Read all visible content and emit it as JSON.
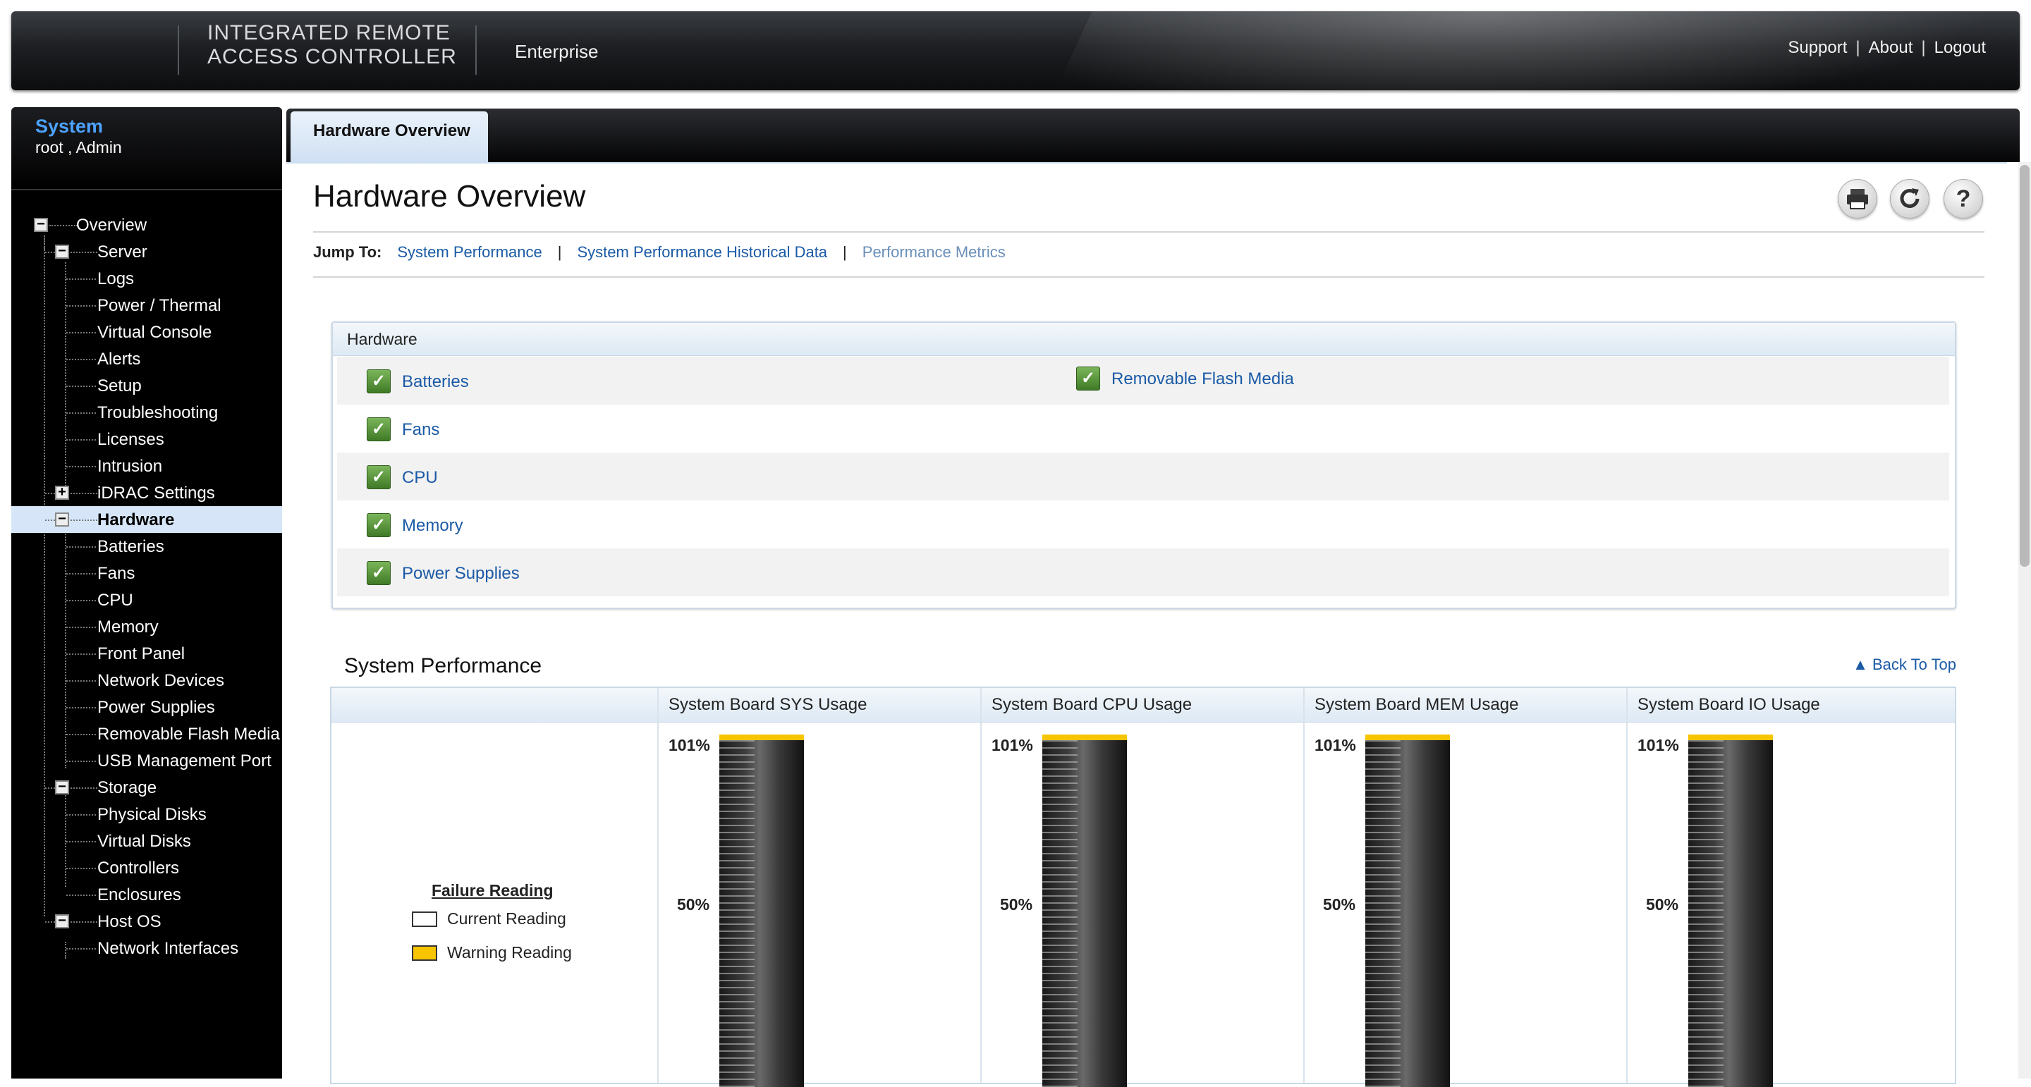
{
  "header": {
    "brand_line1": "INTEGRATED REMOTE",
    "brand_line2": "ACCESS CONTROLLER",
    "edition": "Enterprise",
    "links": {
      "support": "Support",
      "about": "About",
      "logout": "Logout",
      "separator": "|"
    }
  },
  "sidebar": {
    "title": "System",
    "user": "root , Admin",
    "tree": {
      "overview": "Overview",
      "server": "Server",
      "logs": "Logs",
      "power_thermal": "Power / Thermal",
      "virtual_console": "Virtual Console",
      "alerts": "Alerts",
      "setup": "Setup",
      "troubleshooting": "Troubleshooting",
      "licenses": "Licenses",
      "intrusion": "Intrusion",
      "idrac_settings": "iDRAC Settings",
      "hardware": "Hardware",
      "batteries": "Batteries",
      "fans": "Fans",
      "cpu": "CPU",
      "memory": "Memory",
      "front_panel": "Front Panel",
      "network_devices": "Network Devices",
      "power_supplies": "Power Supplies",
      "removable_flash_media": "Removable Flash Media",
      "usb_management_port": "USB Management Port",
      "storage": "Storage",
      "physical_disks": "Physical Disks",
      "virtual_disks": "Virtual Disks",
      "controllers": "Controllers",
      "enclosures": "Enclosures",
      "host_os": "Host OS",
      "network_interfaces": "Network Interfaces"
    },
    "selected": "Hardware"
  },
  "tab": {
    "label": "Hardware Overview"
  },
  "page": {
    "title": "Hardware Overview",
    "toolbar": {
      "print_icon": "printer-icon",
      "refresh_icon": "refresh-icon",
      "help_icon": "help-icon"
    },
    "jump_to": {
      "label": "Jump To:",
      "links": [
        "System Performance",
        "System Performance Historical Data",
        "Performance Metrics"
      ],
      "separator": "|"
    }
  },
  "hardware": {
    "heading": "Hardware",
    "items_left": [
      "Batteries",
      "Fans",
      "CPU",
      "Memory",
      "Power Supplies"
    ],
    "items_right": [
      "Removable Flash Media"
    ],
    "status": "ok",
    "status_color": "#4f8f32"
  },
  "system_performance": {
    "title": "System Performance",
    "back_to_top": "Back To Top",
    "legend": {
      "title": "Failure Reading",
      "current": "Current Reading",
      "warning": "Warning Reading",
      "warning_color": "#f6c400"
    },
    "ticks": [
      "101%",
      "50%"
    ],
    "columns": [
      {
        "header": "System Board SYS Usage"
      },
      {
        "header": "System Board CPU Usage"
      },
      {
        "header": "System Board MEM Usage"
      },
      {
        "header": "System Board IO Usage"
      }
    ]
  }
}
